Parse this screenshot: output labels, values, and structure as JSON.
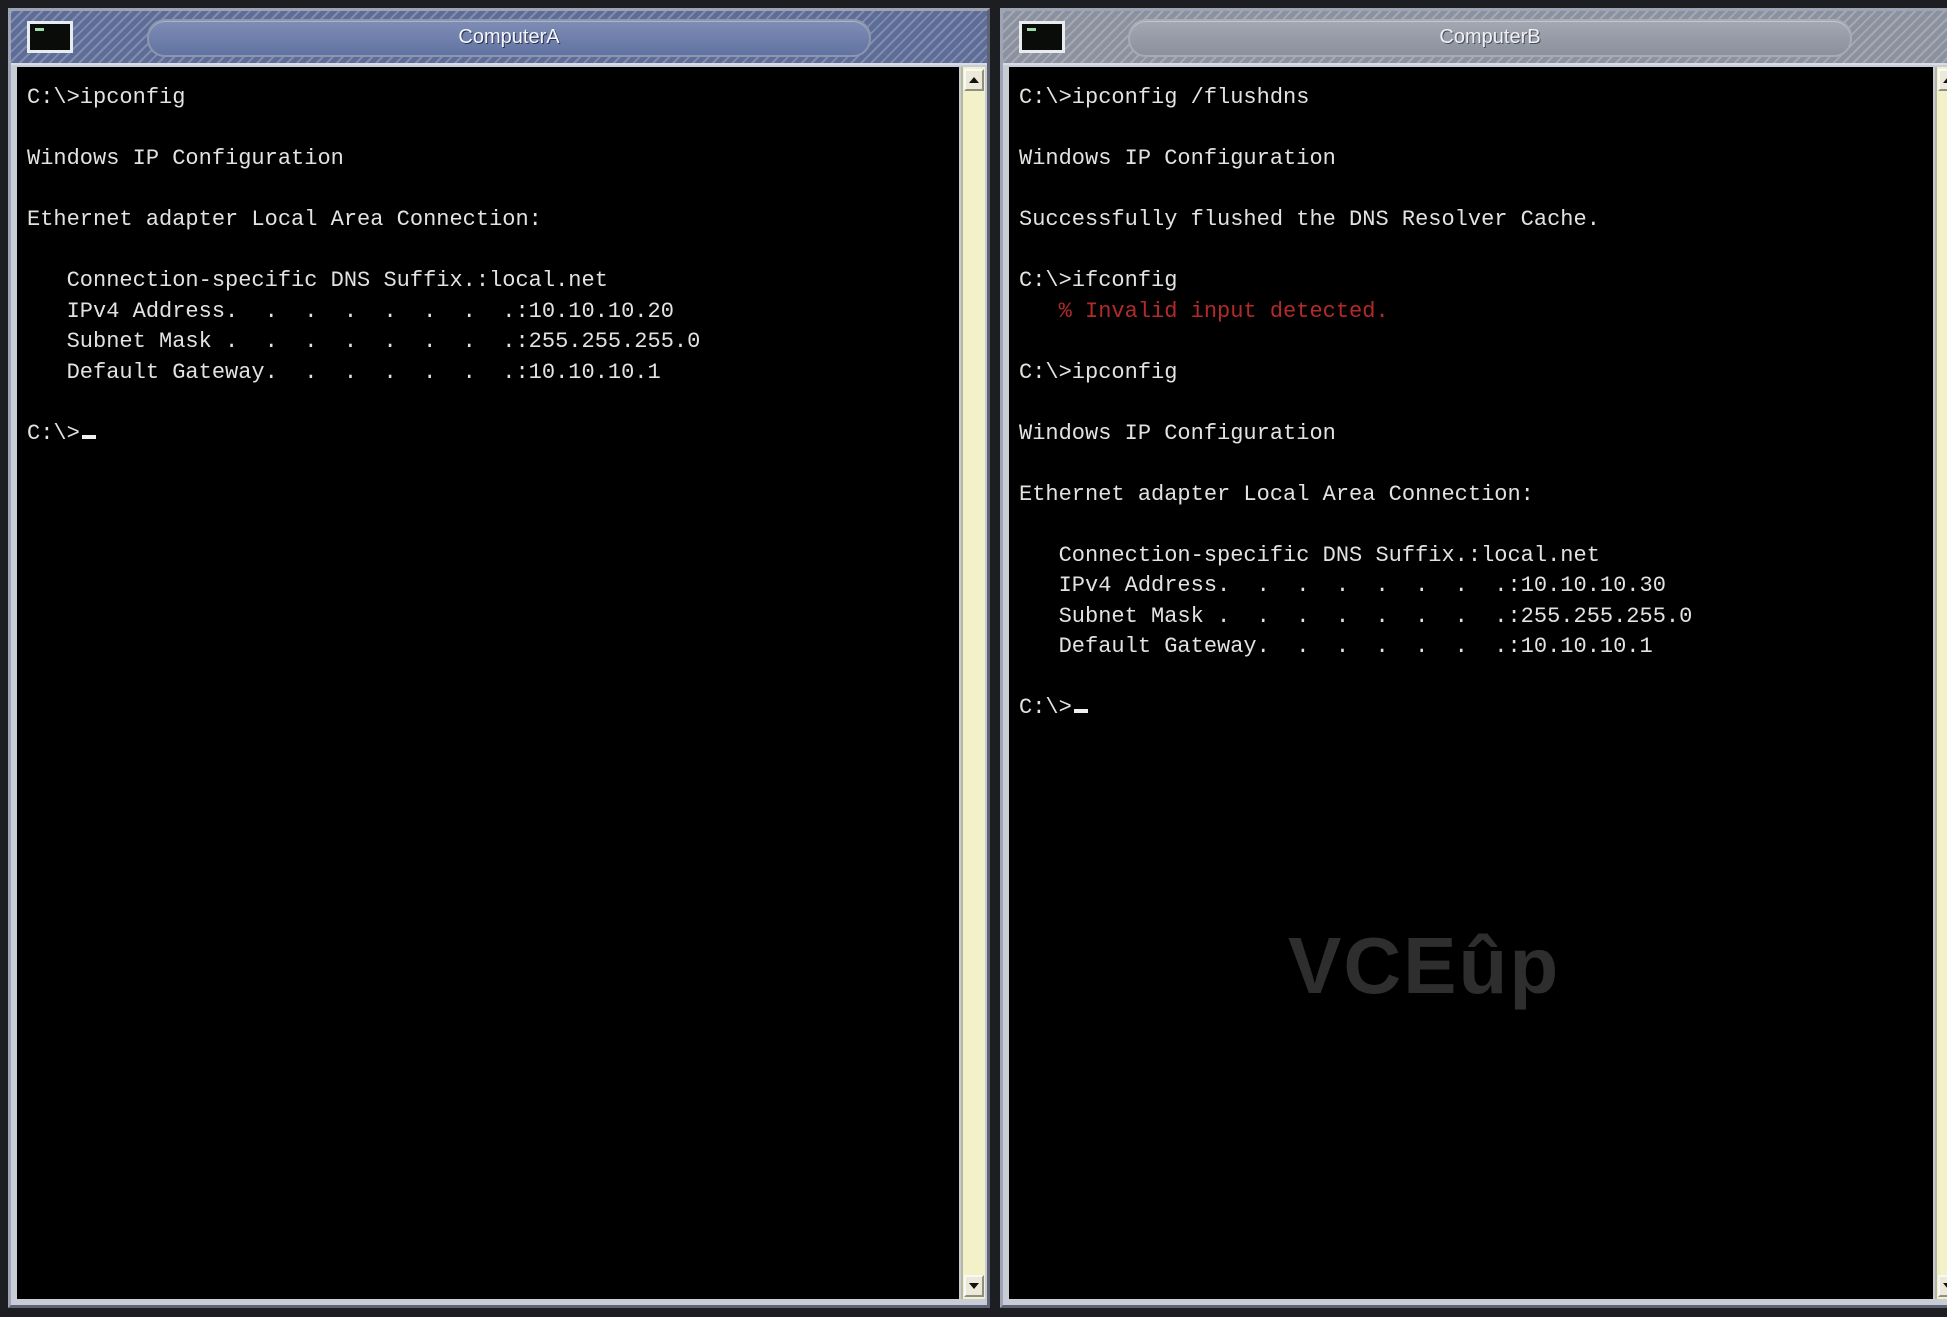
{
  "windows": [
    {
      "title": "ComputerA",
      "lines": [
        {
          "text": "C:\\>ipconfig",
          "style": "normal"
        },
        {
          "text": "",
          "style": "normal"
        },
        {
          "text": "Windows IP Configuration",
          "style": "normal"
        },
        {
          "text": "",
          "style": "normal"
        },
        {
          "text": "Ethernet adapter Local Area Connection:",
          "style": "normal"
        },
        {
          "text": "",
          "style": "normal"
        },
        {
          "text": "   Connection-specific DNS Suffix.:local.net",
          "style": "normal"
        },
        {
          "text": "   IPv4 Address.  .  .  .  .  .  .  .:10.10.10.20",
          "style": "normal"
        },
        {
          "text": "   Subnet Mask .  .  .  .  .  .  .  .:255.255.255.0",
          "style": "normal"
        },
        {
          "text": "   Default Gateway.  .  .  .  .  .  .:10.10.10.1",
          "style": "normal"
        },
        {
          "text": "",
          "style": "normal"
        },
        {
          "text": "C:\\>",
          "style": "prompt"
        }
      ]
    },
    {
      "title": "ComputerB",
      "lines": [
        {
          "text": "C:\\>ipconfig /flushdns",
          "style": "normal"
        },
        {
          "text": "",
          "style": "normal"
        },
        {
          "text": "Windows IP Configuration",
          "style": "normal"
        },
        {
          "text": "",
          "style": "normal"
        },
        {
          "text": "Successfully flushed the DNS Resolver Cache.",
          "style": "normal"
        },
        {
          "text": "",
          "style": "normal"
        },
        {
          "text": "C:\\>ifconfig",
          "style": "normal"
        },
        {
          "text": "   % Invalid input detected.",
          "style": "error"
        },
        {
          "text": "",
          "style": "normal"
        },
        {
          "text": "C:\\>ipconfig",
          "style": "normal"
        },
        {
          "text": "",
          "style": "normal"
        },
        {
          "text": "Windows IP Configuration",
          "style": "normal"
        },
        {
          "text": "",
          "style": "normal"
        },
        {
          "text": "Ethernet adapter Local Area Connection:",
          "style": "normal"
        },
        {
          "text": "",
          "style": "normal"
        },
        {
          "text": "   Connection-specific DNS Suffix.:local.net",
          "style": "normal"
        },
        {
          "text": "   IPv4 Address.  .  .  .  .  .  .  .:10.10.10.30",
          "style": "normal"
        },
        {
          "text": "   Subnet Mask .  .  .  .  .  .  .  .:255.255.255.0",
          "style": "normal"
        },
        {
          "text": "   Default Gateway.  .  .  .  .  .  .:10.10.10.1",
          "style": "normal"
        },
        {
          "text": "",
          "style": "normal"
        },
        {
          "text": "C:\\>",
          "style": "prompt"
        }
      ]
    }
  ],
  "watermark": "VCEûp",
  "colors": {
    "console_bg": "#000000",
    "console_text": "#e2e2e2",
    "error_text": "#b32a2a",
    "scrollbar": "#f3f1c8"
  }
}
